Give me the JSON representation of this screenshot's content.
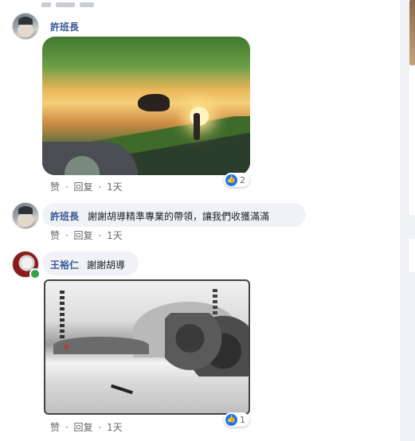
{
  "colors": {
    "link": "#385898",
    "meta": "#65676b",
    "like": "#1877f2",
    "online": "#31a24c"
  },
  "comments": [
    {
      "author": "許班長",
      "text": "",
      "image": "photo-buffalo-sunset",
      "actions": {
        "like": "赞",
        "reply": "回复",
        "time": "1天",
        "sep": "·"
      },
      "reaction_count": "2"
    },
    {
      "author": "許班長",
      "text": "謝謝胡導精準專業的帶領，讓我們收獲滿滿",
      "actions": {
        "like": "赞",
        "reply": "回复",
        "time": "1天",
        "sep": "·"
      }
    },
    {
      "author": "王裕仁",
      "text": "謝謝胡導",
      "image": "photo-ink-landscape",
      "online": true,
      "actions": {
        "like": "赞",
        "reply": "回复",
        "time": "1天",
        "sep": "·"
      },
      "reaction_count": "1"
    }
  ],
  "icons": {
    "reaction": "thumbs-up-icon"
  }
}
